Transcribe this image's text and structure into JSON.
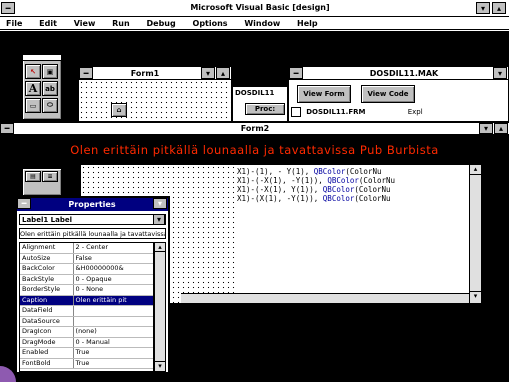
{
  "app": {
    "title": "Microsoft Visual Basic [design]",
    "menu": [
      "File",
      "Edit",
      "View",
      "Run",
      "Debug",
      "Options",
      "Window",
      "Help"
    ]
  },
  "form1": {
    "title": "Form1"
  },
  "form2": {
    "title": "Form2"
  },
  "project": {
    "title": "DOSDIL11.MAK",
    "view_form": "View Form",
    "view_code": "View Code",
    "file": "DOSDIL11.FRM",
    "file_note": "Expl"
  },
  "code_fragment": {
    "name": "DOSDIL11",
    "proc": "Proc:"
  },
  "banner": {
    "text": "Olen erittäin pitkällä lounaalla ja tavattavissa Pub Burbista",
    "color": "#ff2a00"
  },
  "code": {
    "lines": [
      {
        "pre": "X1)-(1),  - Y(1), ",
        "fn": "QBColor",
        "post": "(ColorNu"
      },
      {
        "pre": "X1)-(-X(1), -Y(1)), ",
        "fn": "QBColor",
        "post": "(ColorNu"
      },
      {
        "pre": "X1)-(-X(1),  Y(1)), ",
        "fn": "QBColor",
        "post": "(ColorNu"
      },
      {
        "pre": "X1)-(X(1),  -Y(1)), ",
        "fn": "QBColor",
        "post": "(ColorNu"
      }
    ]
  },
  "properties": {
    "title": "Properties",
    "object": "Label1  Label",
    "value": "Olen erittäin pitkällä lounaalla ja tavattavissa Pub Burbista",
    "rows": [
      {
        "k": "Alignment",
        "v": "2 - Center"
      },
      {
        "k": "AutoSize",
        "v": "False"
      },
      {
        "k": "BackColor",
        "v": "&H00000000&"
      },
      {
        "k": "BackStyle",
        "v": "0 - Opaque"
      },
      {
        "k": "BorderStyle",
        "v": "0 - None"
      },
      {
        "k": "Caption",
        "v": "Olen erittäin pit"
      },
      {
        "k": "DataField",
        "v": ""
      },
      {
        "k": "DataSource",
        "v": ""
      },
      {
        "k": "DragIcon",
        "v": "(none)"
      },
      {
        "k": "DragMode",
        "v": "0 - Manual"
      },
      {
        "k": "Enabled",
        "v": "True"
      },
      {
        "k": "FontBold",
        "v": "True"
      }
    ],
    "selected_index": 5
  }
}
